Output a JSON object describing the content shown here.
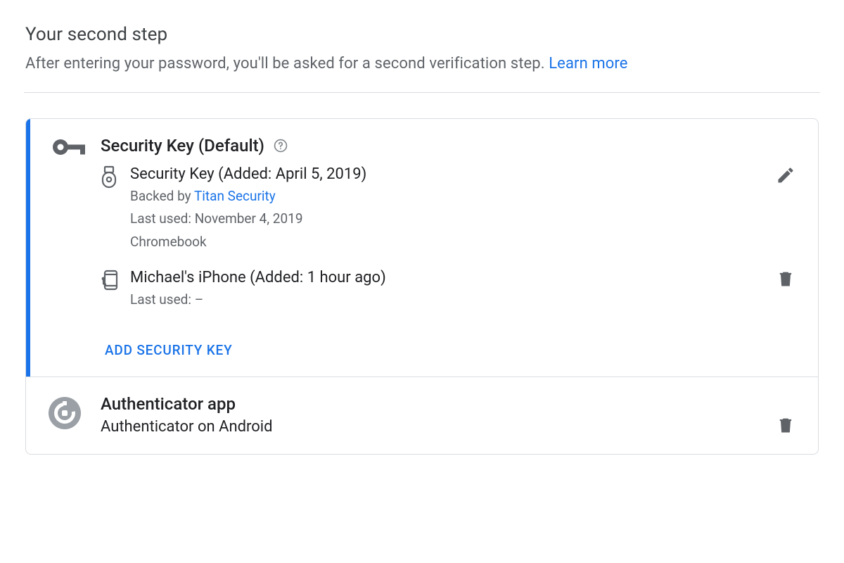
{
  "header": {
    "title": "Your second step",
    "description": "After entering your password, you'll be asked for a second verification step.",
    "learn_more": "Learn more"
  },
  "sections": {
    "security_key": {
      "title": "Security Key (Default)",
      "add_button": "ADD SECURITY KEY",
      "items": [
        {
          "name_line": "Security Key (Added: April 5, 2019)",
          "backed_prefix": "Backed by ",
          "backed_link": "Titan Security",
          "last_used": "Last used: November 4, 2019",
          "device": "Chromebook",
          "action": "edit"
        },
        {
          "name_line": "Michael's iPhone (Added: 1 hour ago)",
          "last_used": "Last used: –",
          "action": "delete"
        }
      ]
    },
    "authenticator": {
      "title": "Authenticator app",
      "device_line": "Authenticator on Android",
      "action": "delete"
    }
  }
}
